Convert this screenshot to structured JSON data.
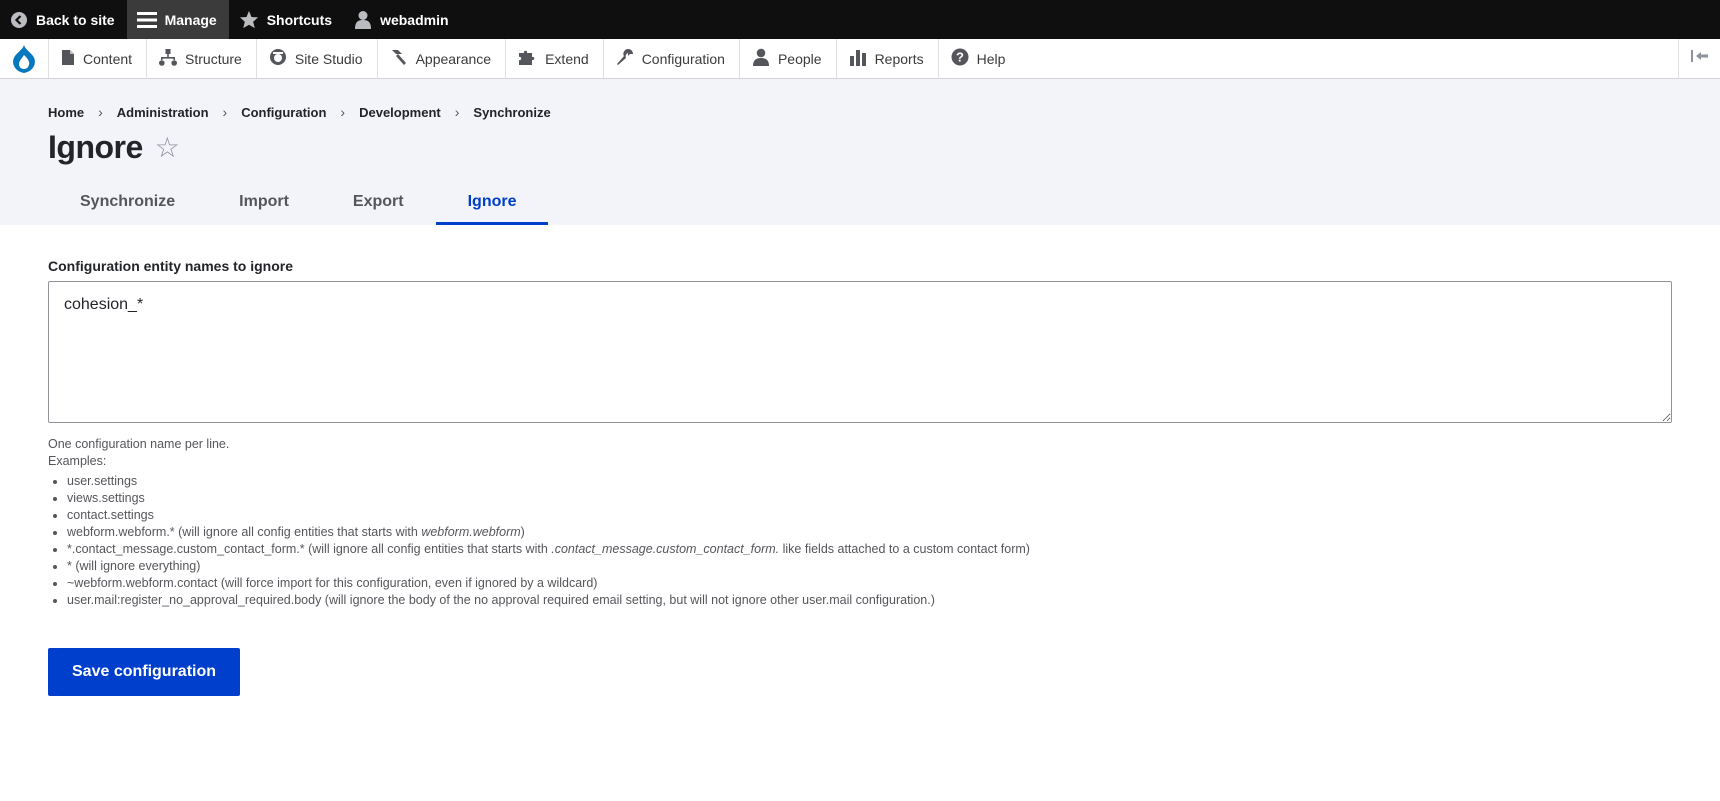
{
  "toolbar": {
    "back_to_site": "Back to site",
    "manage": "Manage",
    "shortcuts": "Shortcuts",
    "user": "webadmin"
  },
  "admin_menu": {
    "items": [
      {
        "label": "Content",
        "icon": "file-icon"
      },
      {
        "label": "Structure",
        "icon": "sitemap-icon"
      },
      {
        "label": "Site Studio",
        "icon": "site-studio-icon"
      },
      {
        "label": "Appearance",
        "icon": "paint-icon"
      },
      {
        "label": "Extend",
        "icon": "puzzle-icon"
      },
      {
        "label": "Configuration",
        "icon": "wrench-icon"
      },
      {
        "label": "People",
        "icon": "person-icon"
      },
      {
        "label": "Reports",
        "icon": "bar-chart-icon"
      },
      {
        "label": "Help",
        "icon": "help-icon"
      }
    ]
  },
  "breadcrumb": [
    "Home",
    "Administration",
    "Configuration",
    "Development",
    "Synchronize"
  ],
  "page": {
    "title": "Ignore",
    "star_glyph": "☆"
  },
  "tabs": [
    {
      "label": "Synchronize",
      "active": false
    },
    {
      "label": "Import",
      "active": false
    },
    {
      "label": "Export",
      "active": false
    },
    {
      "label": "Ignore",
      "active": true
    }
  ],
  "form": {
    "label": "Configuration entity names to ignore",
    "value": "cohesion_*",
    "description_line1": "One configuration name per line.",
    "description_line2": "Examples:",
    "examples": {
      "e1": "user.settings",
      "e2": "views.settings",
      "e3": "contact.settings",
      "e4_pre": "webform.webform.* (will ignore all config entities that starts with ",
      "e4_em": "webform.webform",
      "e4_post": ")",
      "e5_pre": "*.contact_message.custom_contact_form.* (will ignore all config entities that starts with ",
      "e5_em": ".contact_message.custom_contact_form.",
      "e5_post": " like fields attached to a custom contact form)",
      "e6": "* (will ignore everything)",
      "e7": "~webform.webform.contact (will force import for this configuration, even if ignored by a wildcard)",
      "e8": "user.mail:register_no_approval_required.body (will ignore the body of the no approval required email setting, but will not ignore other user.mail configuration.)"
    },
    "save_label": "Save configuration"
  },
  "colors": {
    "accent": "#003ecc",
    "toolbar_bg": "#0f0f0f",
    "header_bg": "#f3f4f9",
    "drupal_blue": "#0678be"
  }
}
